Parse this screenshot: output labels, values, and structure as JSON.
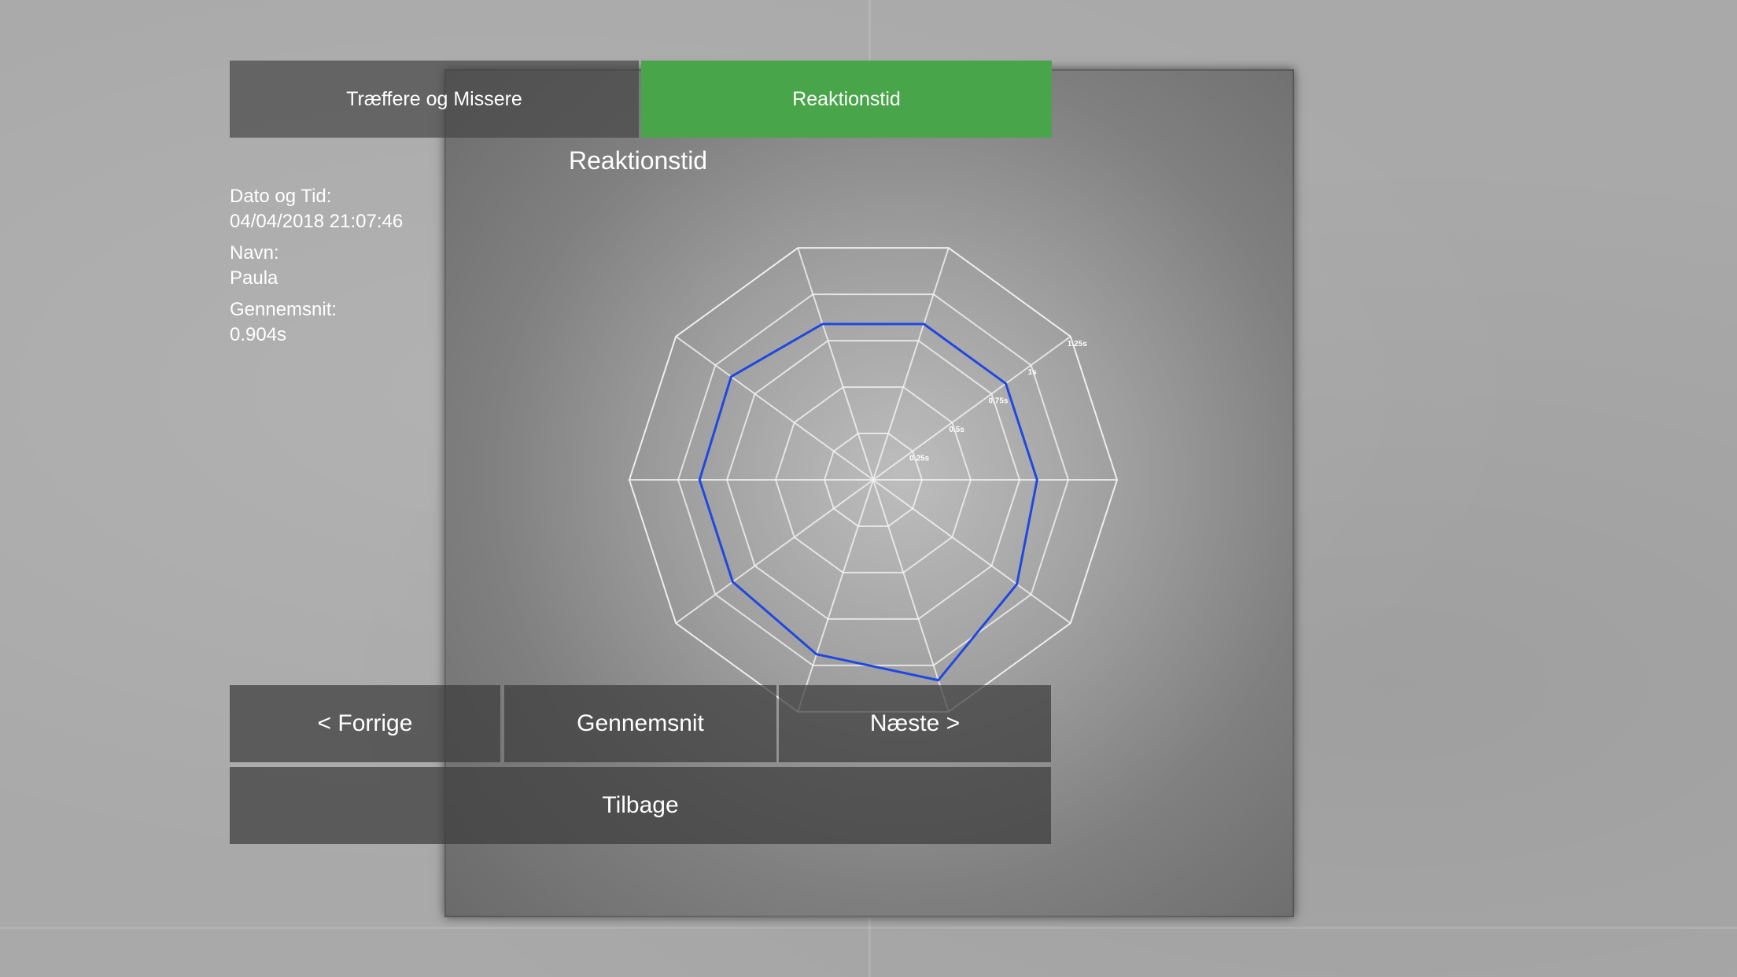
{
  "tabs": {
    "hits_label": "Træffere og Missere",
    "reaction_label": "Reaktionstid"
  },
  "chart_title": "Reaktionstid",
  "info": {
    "date_label": "Dato og Tid:",
    "date_value": "04/04/2018 21:07:46",
    "name_label": "Navn:",
    "name_value": "Paula",
    "avg_label": "Gennemsnit:",
    "avg_value": "0.904s"
  },
  "buttons": {
    "prev": "< Forrige",
    "average": "Gennemsnit",
    "next": "Næste >",
    "back": "Tilbage"
  },
  "colors": {
    "active_tab": "#49a54a",
    "series_line": "#1f48e0",
    "grid": "#f2f2f2"
  },
  "chart_data": {
    "type": "radar",
    "axes_count": 10,
    "ring_labels": [
      "0.25s",
      "0.5s",
      "0.75s",
      "1s",
      "1.25s"
    ],
    "ring_values": [
      0.25,
      0.5,
      0.75,
      1.0,
      1.25
    ],
    "rmax": 1.25,
    "series": [
      {
        "values": [
          0.84,
          0.84,
          0.84,
          0.84,
          0.9,
          0.89,
          0.89,
          0.94,
          1.08,
          0.91
        ]
      }
    ]
  }
}
